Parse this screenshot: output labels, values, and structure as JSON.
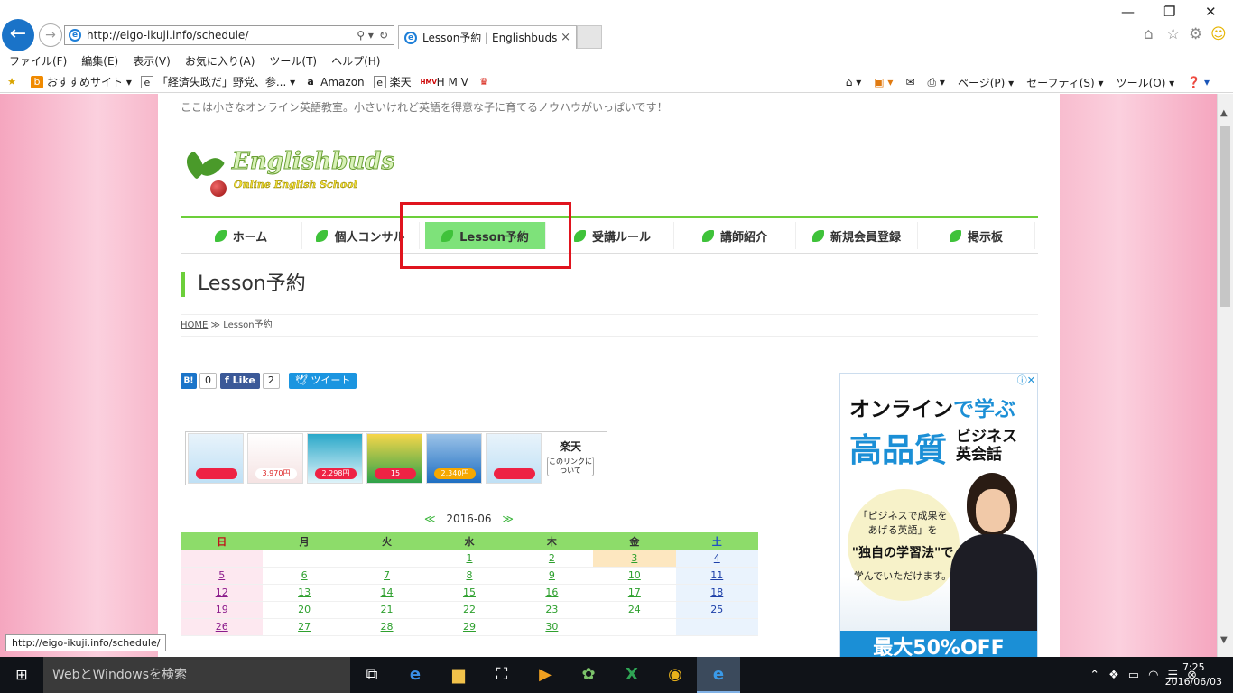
{
  "browser": {
    "url": "http://eigo-ikuji.info/schedule/",
    "tab_title": "Lesson予約 | Englishbuds",
    "status_url": "http://eigo-ikuji.info/schedule/"
  },
  "menu": [
    "ファイル(F)",
    "編集(E)",
    "表示(V)",
    "お気に入り(A)",
    "ツール(T)",
    "ヘルプ(H)"
  ],
  "favorites": [
    {
      "label": "おすすめサイト ▾",
      "icon": "orange-b-icon"
    },
    {
      "label": "「経済失政だ」野党、参... ▾",
      "icon": "page-icon"
    },
    {
      "label": "Amazon",
      "icon": "amazon-icon"
    },
    {
      "label": "楽天",
      "icon": "page-icon"
    },
    {
      "label": "H M V",
      "icon": "hmv-icon"
    },
    {
      "label": "",
      "icon": "crown-icon"
    }
  ],
  "commandbar": [
    "ページ(P) ▾",
    "セーフティ(S) ▾",
    "ツール(O) ▾"
  ],
  "site": {
    "tagline": "ここは小さなオンライン英語教室。小さいけれど英語を得意な子に育てるノウハウがいっぱいです！",
    "logo_main": "Englishbuds",
    "logo_sub": "Online English School",
    "nav": [
      "ホーム",
      "個人コンサル",
      "Lesson予約",
      "受講ルール",
      "講師紹介",
      "新規会員登録",
      "掲示板"
    ],
    "active_nav": 2,
    "page_title": "Lesson予約",
    "breadcrumb_home": "HOME",
    "breadcrumb_sep": "≫",
    "breadcrumb_current": "Lesson予約"
  },
  "share": {
    "hatena_label": "B!",
    "hatena_count": "0",
    "fb_label": "Like",
    "fb_count": "2",
    "tweet_label": "ツイート"
  },
  "rakuten": {
    "logo": "楽天",
    "note": "このリンクについて",
    "prices": [
      "",
      "3,970円",
      "2,298円",
      "15",
      "2,340円",
      ""
    ]
  },
  "calendar": {
    "prev": "≪",
    "next": "≫",
    "month": "2016-06",
    "weekdays": [
      "日",
      "月",
      "火",
      "水",
      "木",
      "金",
      "土"
    ],
    "weeks": [
      [
        "",
        "",
        "",
        "1",
        "2",
        "3",
        "4"
      ],
      [
        "5",
        "6",
        "7",
        "8",
        "9",
        "10",
        "11"
      ],
      [
        "12",
        "13",
        "14",
        "15",
        "16",
        "17",
        "18"
      ],
      [
        "19",
        "20",
        "21",
        "22",
        "23",
        "24",
        "25"
      ],
      [
        "26",
        "27",
        "28",
        "29",
        "30",
        "",
        ""
      ]
    ],
    "today": "3"
  },
  "ad": {
    "line1_a": "オンライン",
    "line1_b": "で学ぶ",
    "line2": "高品質",
    "line3a": "ビジネス",
    "line3b": "英会話",
    "circle1": "「ビジネスで成果を",
    "circle1b": "あげる英語」を",
    "circle2": "\"独自の学習法\"で",
    "circle3": "学んでいただけます。",
    "bottom": "最大50%OFF"
  },
  "taskbar": {
    "search_placeholder": "WebとWindowsを検索",
    "time": "7:25",
    "date": "2016/06/03"
  },
  "colors": {
    "accent_green": "#6ccf3a",
    "highlight_red": "#e0141e",
    "ie_blue": "#1a73c8"
  }
}
